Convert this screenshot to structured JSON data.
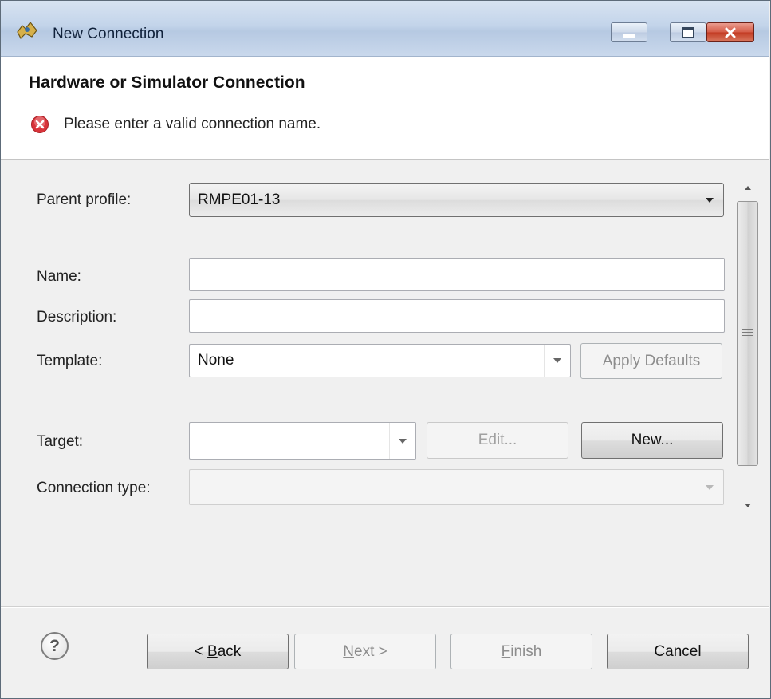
{
  "window": {
    "title": "New Connection"
  },
  "header": {
    "title": "Hardware or Simulator Connection",
    "error_message": "Please enter a valid connection name."
  },
  "form": {
    "parent_profile": {
      "label": "Parent profile:",
      "value": "RMPE01-13"
    },
    "name": {
      "label": "Name:",
      "value": ""
    },
    "description": {
      "label": "Description:",
      "value": ""
    },
    "template": {
      "label": "Template:",
      "value": "None",
      "apply_defaults_label": "Apply Defaults"
    },
    "target": {
      "label": "Target:",
      "value": "",
      "edit_label": "Edit...",
      "new_label": "New..."
    },
    "connection_type": {
      "label": "Connection type:",
      "value": ""
    }
  },
  "footer": {
    "back_prefix": "< ",
    "back_mnemonic": "B",
    "back_rest": "ack",
    "next_mnemonic": "N",
    "next_rest": "ext >",
    "finish_mnemonic": "F",
    "finish_rest": "inish",
    "cancel_label": "Cancel"
  },
  "icons": {
    "app": "new-connection-app-icon",
    "error": "error-icon",
    "help": "help-icon"
  },
  "colors": {
    "error": "#d9333a",
    "titlebar": "#c3d4ea",
    "close": "#c23b23"
  }
}
